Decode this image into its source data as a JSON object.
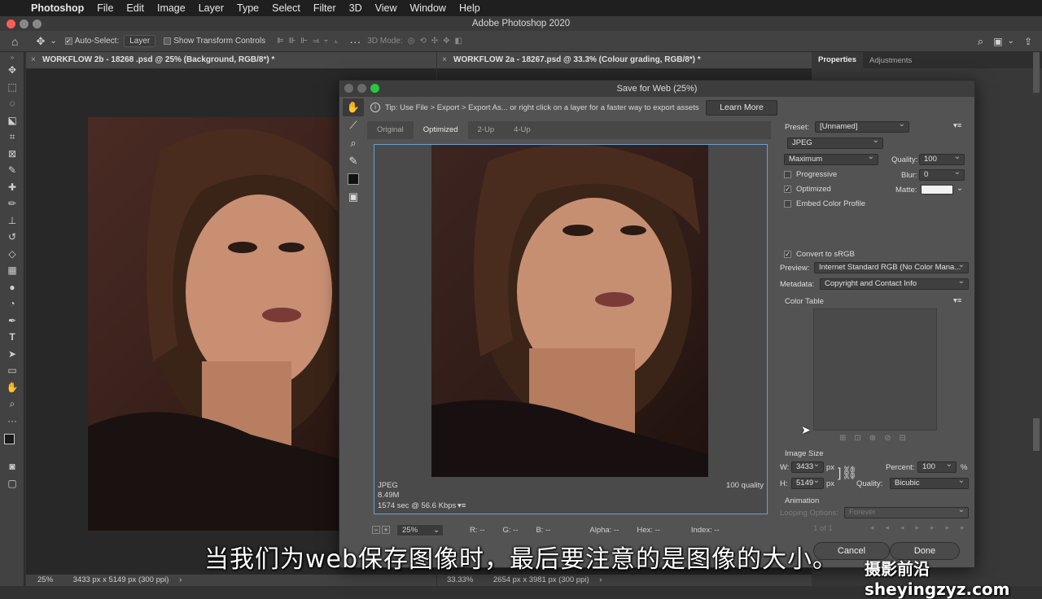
{
  "menubar": {
    "app": "Photoshop",
    "items": [
      "File",
      "Edit",
      "Image",
      "Layer",
      "Type",
      "Select",
      "Filter",
      "3D",
      "View",
      "Window",
      "Help"
    ]
  },
  "window_title": "Adobe Photoshop 2020",
  "options": {
    "auto_select": "Auto-Select:",
    "layer": "Layer",
    "transform": "Show Transform Controls",
    "mode3d": "3D Mode:"
  },
  "doc1": {
    "tab": "WORKFLOW 2b - 18268 .psd @ 25% (Background, RGB/8*) *",
    "zoom": "25%",
    "size": "3433 px x 5149 px (300 ppi)"
  },
  "doc2": {
    "tab": "WORKFLOW 2a - 18267.psd @ 33.3% (Colour grading, RGB/8*) *",
    "zoom": "33.33%",
    "size": "2654 px x 3981 px (300 ppi)"
  },
  "panel": {
    "tab1": "Properties",
    "tab2": "Adjustments"
  },
  "dialog": {
    "title": "Save for Web (25%)",
    "tip": "Tip: Use File > Export > Export As...  or right click on a layer for a faster way to export assets",
    "learn_more": "Learn More",
    "tabs": [
      "Original",
      "Optimized",
      "2-Up",
      "4-Up"
    ],
    "info_format": "JPEG",
    "info_size": "8.49M",
    "info_time": "1574 sec @ 56.6 Kbps",
    "info_quality": "100 quality",
    "zoom": "25%",
    "r": "R: --",
    "g": "G: --",
    "b": "B: --",
    "alpha": "Alpha: --",
    "hex": "Hex: --",
    "index": "Index: --",
    "settings": {
      "preset_label": "Preset:",
      "preset": "[Unnamed]",
      "format": "JPEG",
      "quality_level": "Maximum",
      "quality_label": "Quality:",
      "quality": "100",
      "progressive": "Progressive",
      "blur_label": "Blur:",
      "blur": "0",
      "optimized": "Optimized",
      "matte_label": "Matte:",
      "embed": "Embed Color Profile",
      "convert": "Convert to sRGB",
      "preview_label": "Preview:",
      "preview": "Internet Standard RGB (No Color Mana...",
      "metadata_label": "Metadata:",
      "metadata": "Copyright and Contact Info",
      "color_table": "Color Table",
      "image_size": "Image Size",
      "w_label": "W:",
      "w": "3433",
      "h_label": "H:",
      "h": "5149",
      "px": "px",
      "percent_label": "Percent:",
      "percent": "100",
      "pct": "%",
      "resample_label": "Quality:",
      "resample": "Bicubic",
      "animation": "Animation",
      "looping_label": "Looping Options:",
      "looping": "Forever",
      "frame": "1 of 1"
    },
    "cancel": "Cancel",
    "done": "Done"
  },
  "subtitle": "当我们为web保存图像时，最后要注意的是图像的大小。",
  "watermark": "摄影前沿 sheyingzyz.com"
}
